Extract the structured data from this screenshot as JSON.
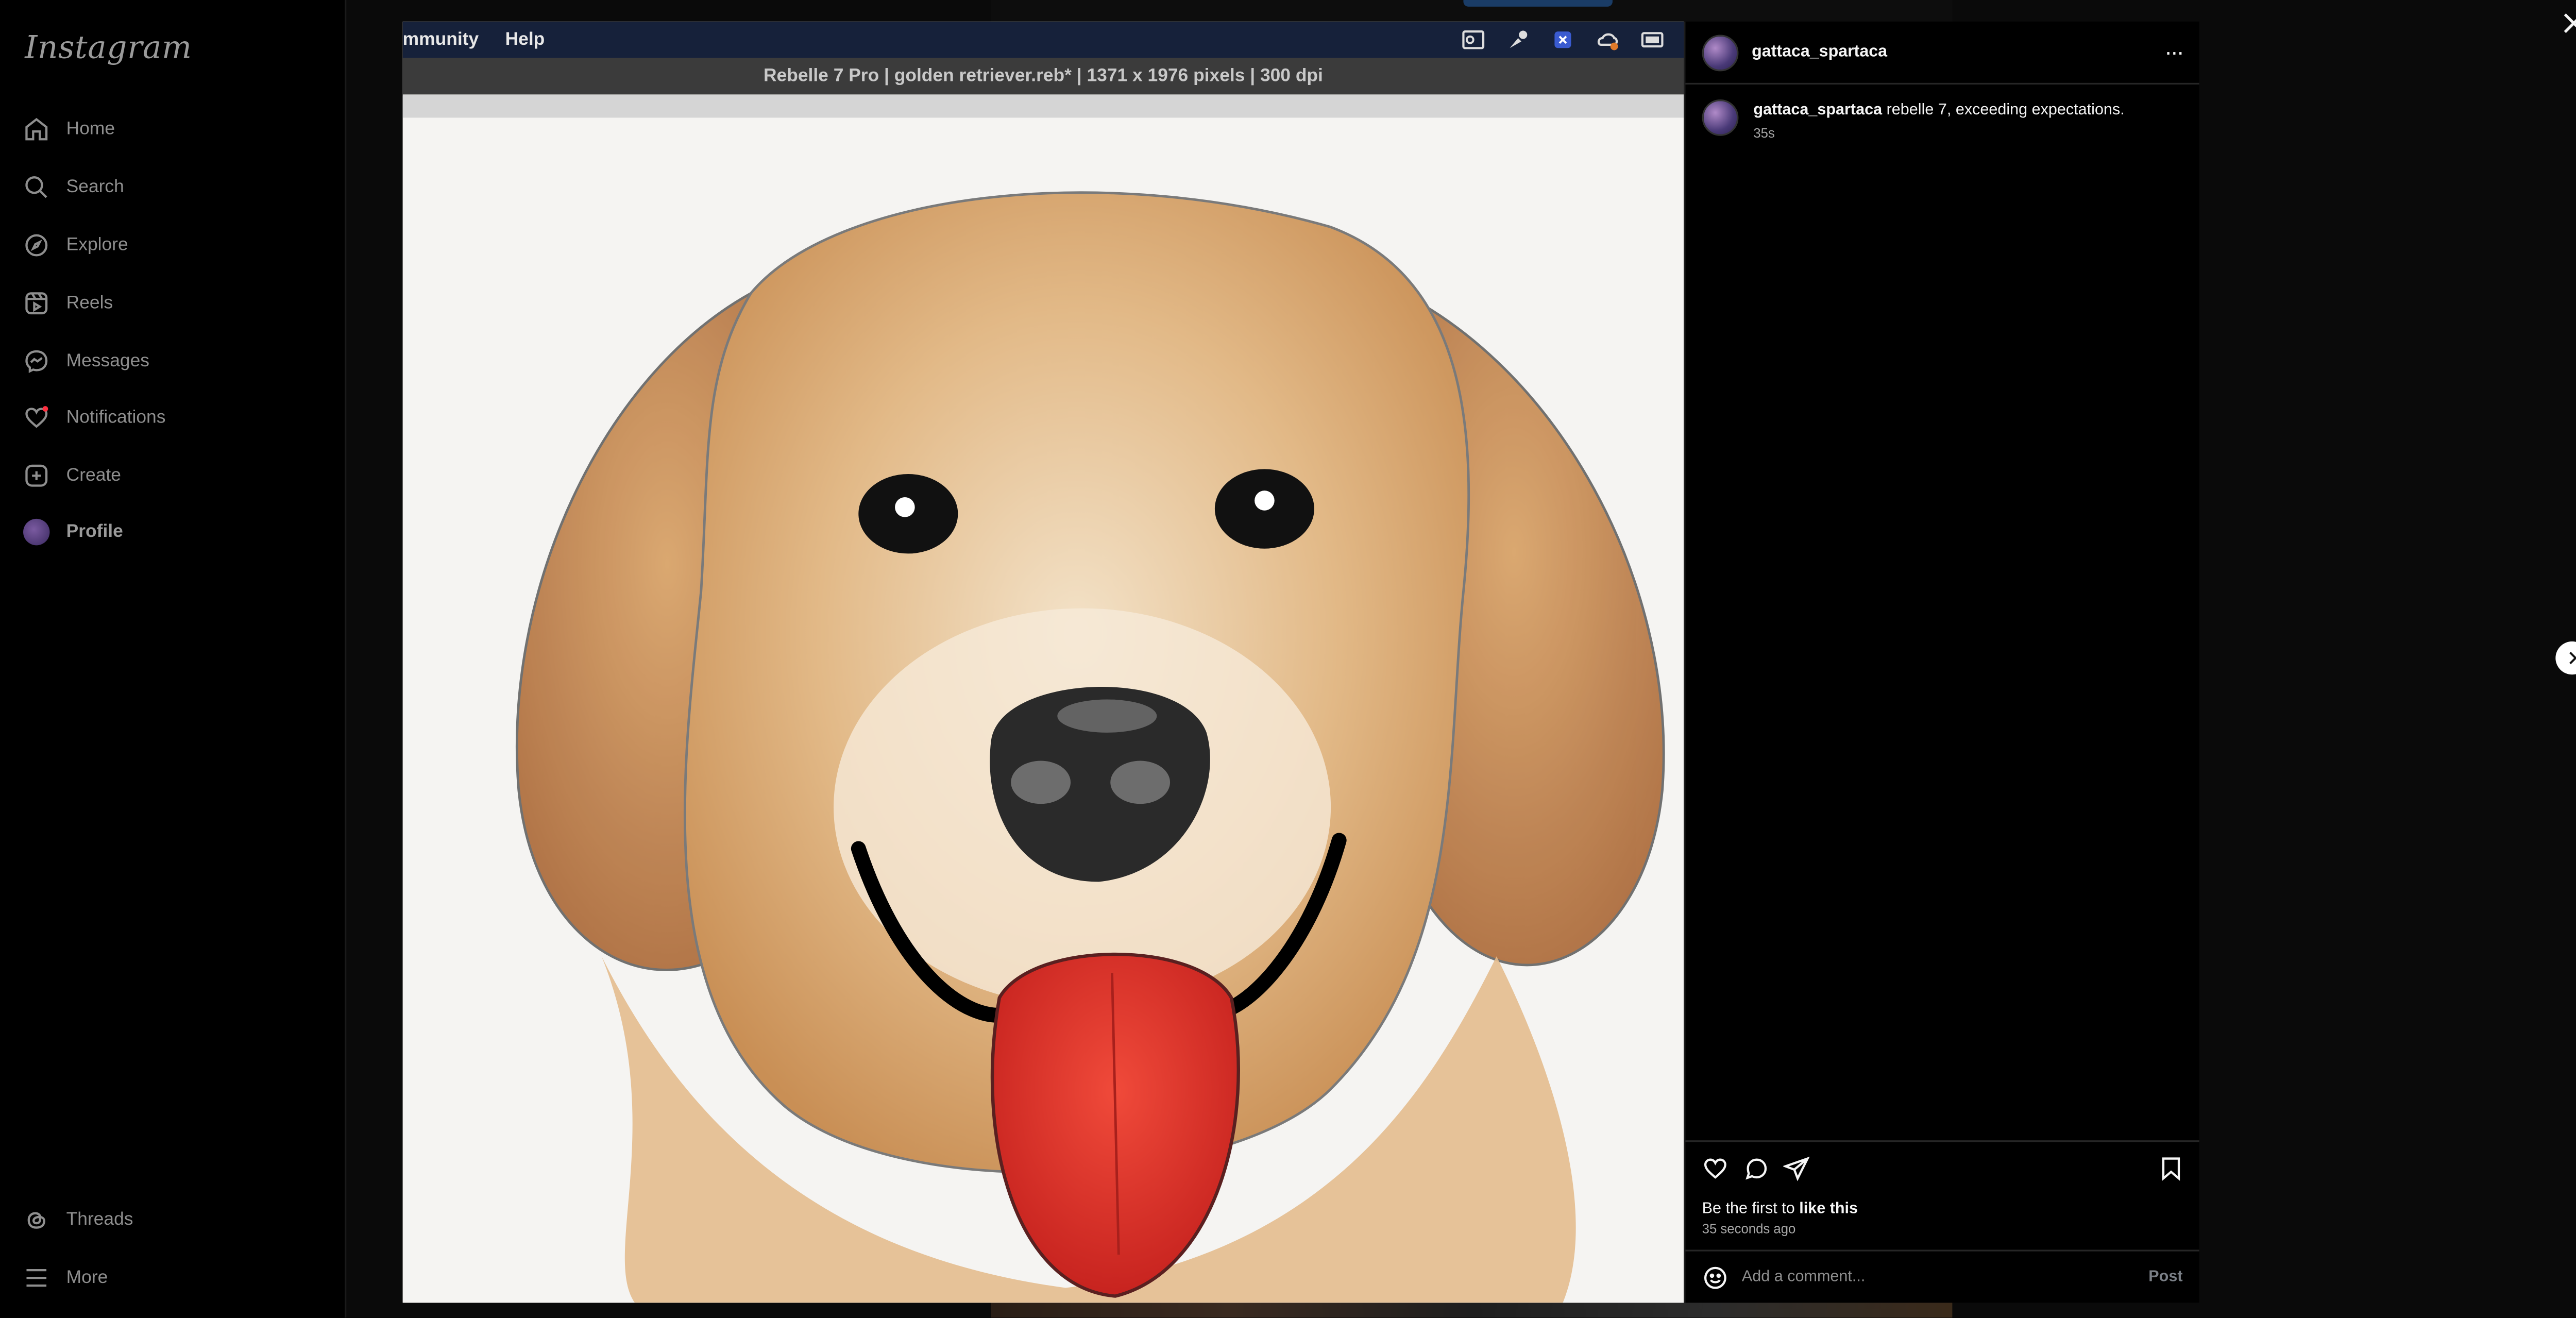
{
  "app": {
    "logo": "Instagram"
  },
  "sidebar": {
    "items": [
      {
        "label": "Home",
        "icon": "home-icon"
      },
      {
        "label": "Search",
        "icon": "search-icon"
      },
      {
        "label": "Explore",
        "icon": "compass-icon"
      },
      {
        "label": "Reels",
        "icon": "reels-icon"
      },
      {
        "label": "Messages",
        "icon": "messenger-icon"
      },
      {
        "label": "Notifications",
        "icon": "heart-icon"
      },
      {
        "label": "Create",
        "icon": "plus-square-icon"
      },
      {
        "label": "Profile",
        "icon": "avatar"
      }
    ],
    "bottom": [
      {
        "label": "Threads",
        "icon": "threads-icon"
      },
      {
        "label": "More",
        "icon": "menu-icon"
      }
    ]
  },
  "post_image": {
    "menu": [
      "mmunity",
      "Help"
    ],
    "window_title": "Rebelle 7 Pro | golden retriever.reb* | 1371 x 1976 pixels | 300 dpi",
    "subject": "watercolor golden retriever painting"
  },
  "post": {
    "username": "gattaca_spartaca",
    "caption_user": "gattaca_spartaca",
    "caption_text": "rebelle 7, exceeding expectations.",
    "caption_time": "35s",
    "likes_prefix": "Be the first to ",
    "likes_link": "like this",
    "timestamp": "35 seconds ago",
    "comment_placeholder": "Add a comment...",
    "post_label": "Post",
    "more_label": "···"
  }
}
